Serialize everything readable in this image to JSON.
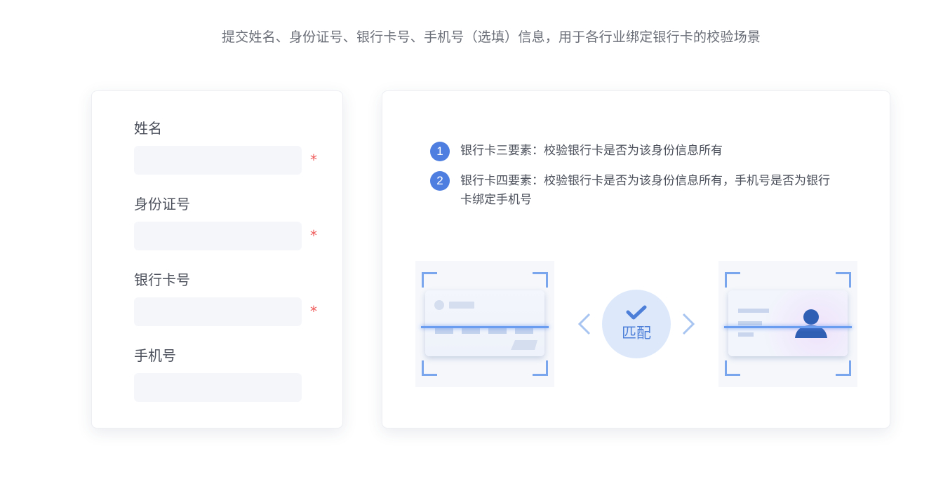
{
  "headline": "提交姓名、身份证号、银行卡号、手机号（选填）信息，用于各行业绑定银行卡的校验场景",
  "form": {
    "fields": [
      {
        "label": "姓名",
        "value": "",
        "required": true,
        "required_mark": "*"
      },
      {
        "label": "身份证号",
        "value": "",
        "required": true,
        "required_mark": "*"
      },
      {
        "label": "银行卡号",
        "value": "",
        "required": true,
        "required_mark": "*"
      },
      {
        "label": "手机号",
        "value": "",
        "required": false
      }
    ]
  },
  "info": {
    "rules": [
      {
        "number": "1",
        "text": "银行卡三要素：校验银行卡是否为该身份信息所有"
      },
      {
        "number": "2",
        "text": "银行卡四要素：校验银行卡是否为该身份信息所有，手机号是否为银行卡绑定手机号"
      }
    ],
    "illustration": {
      "left_card_icon": "bank-card-icon",
      "right_card_icon": "id-card-icon",
      "match_icon": "check-icon",
      "match_label": "匹配",
      "accent_color": "#4e7fe0",
      "scan_color": "#6a9df0"
    }
  }
}
